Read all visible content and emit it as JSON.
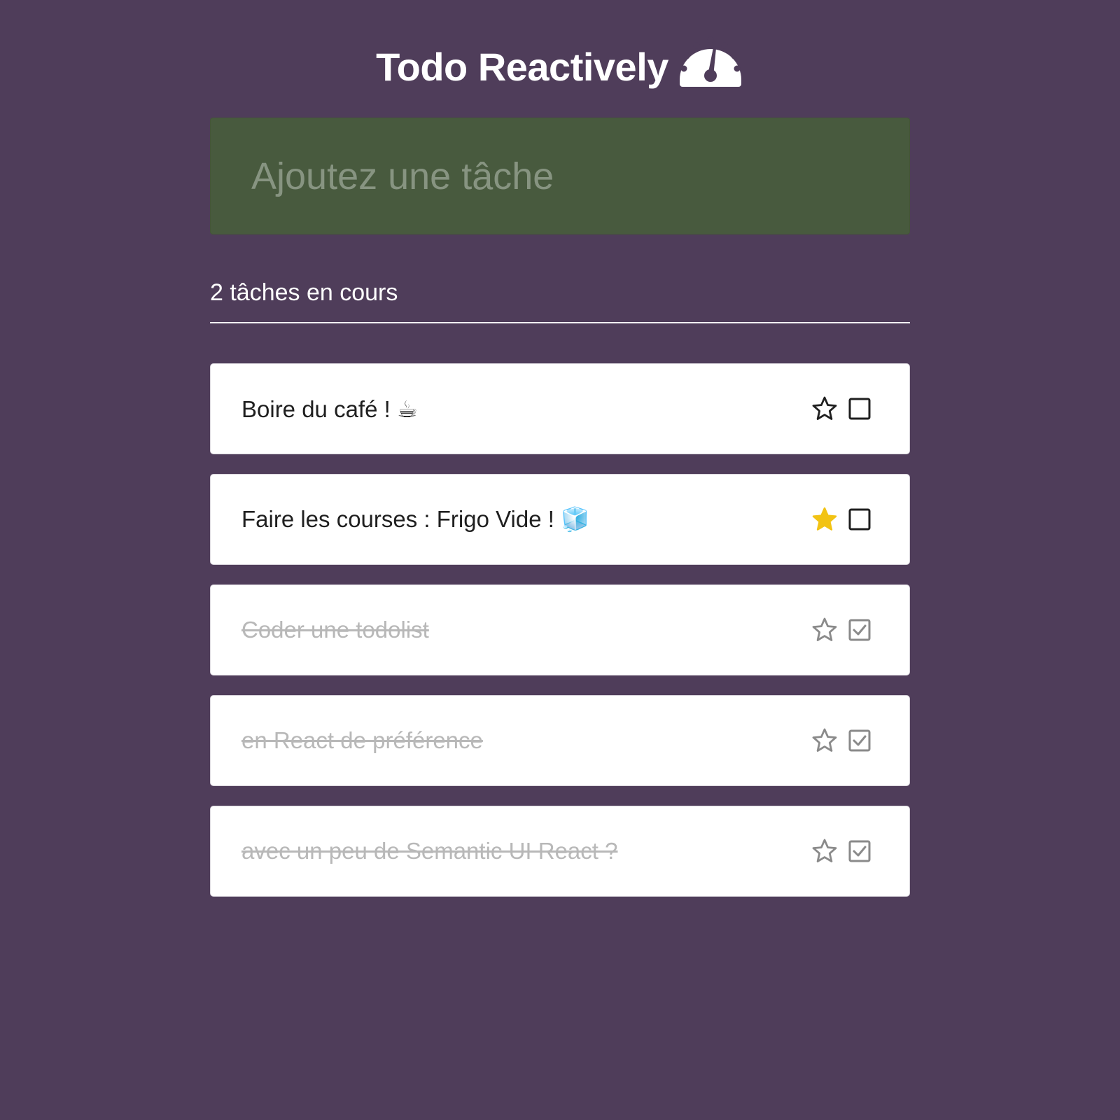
{
  "app": {
    "title": "Todo Reactively",
    "title_icon": "dashboard-gauge-icon"
  },
  "input": {
    "placeholder": "Ajoutez une tâche",
    "value": ""
  },
  "counter": {
    "text": "2 tâches en cours"
  },
  "tasks": [
    {
      "label": "Boire du café ! ☕",
      "starred": false,
      "done": false
    },
    {
      "label": "Faire les courses : Frigo Vide ! 🧊",
      "starred": true,
      "done": false
    },
    {
      "label": "Coder une todolist",
      "starred": false,
      "done": true
    },
    {
      "label": "en React de préférence",
      "starred": false,
      "done": true
    },
    {
      "label": "avec un peu de Semantic UI React ?",
      "starred": false,
      "done": true
    }
  ],
  "colors": {
    "background": "#4f3d5a",
    "input_background": "#485a3e",
    "star_active": "#f2c314",
    "card": "#ffffff"
  }
}
